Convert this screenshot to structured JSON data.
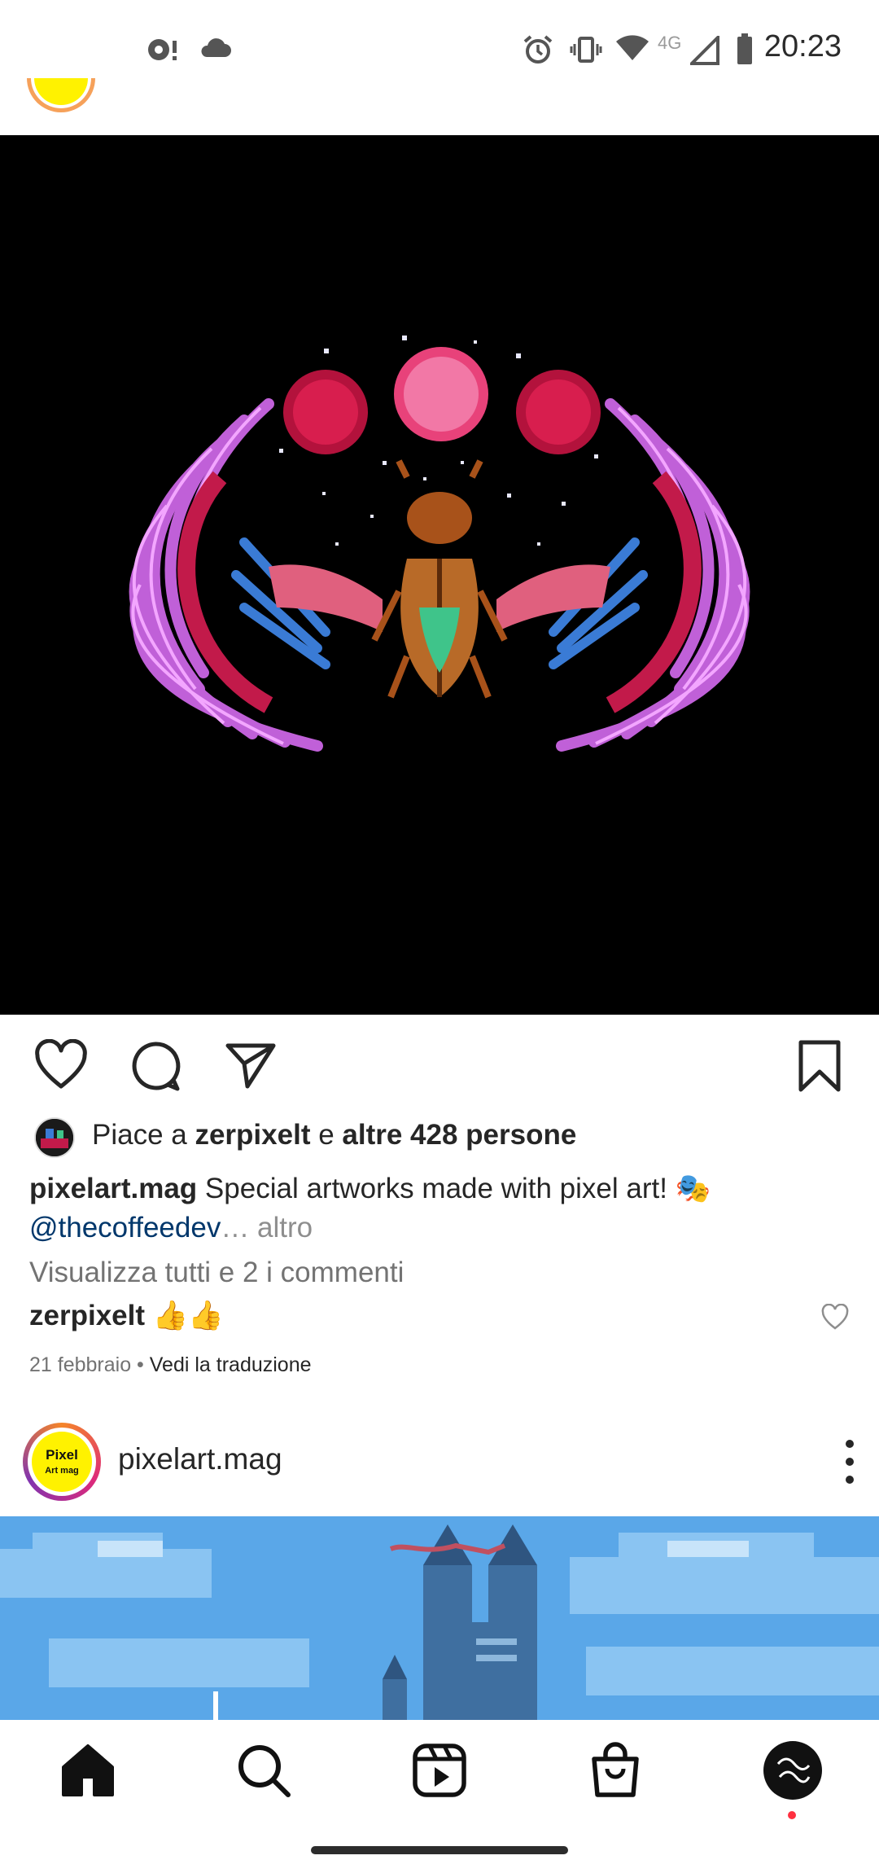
{
  "status_bar": {
    "time": "20:23",
    "network": "4G",
    "icons": [
      "notification-dot-icon",
      "cloud-icon",
      "alarm-icon",
      "vibrate-icon",
      "wifi-icon",
      "cell-signal-icon",
      "battery-icon"
    ]
  },
  "post": {
    "likes": {
      "prefix": "Piace a ",
      "user": "zerpixelt",
      "middle": " e ",
      "others": "altre 428 persone"
    },
    "caption": {
      "username": "pixelart.mag",
      "text": " Special artworks made with pixel art! 🎭",
      "mention": "@thecoffeedev",
      "more": "… altro"
    },
    "view_comments": "Visualizza tutti e 2 i commenti",
    "comment": {
      "username": "zerpixelt",
      "text": " 👍👍"
    },
    "date": "21 febbraio",
    "separator": " • ",
    "translate": "Vedi la traduzione"
  },
  "next_post": {
    "username": "pixelart.mag",
    "avatar_text_line1": "Pixel",
    "avatar_text_line2": "Art mag"
  },
  "colors": {
    "link": "#00376b",
    "muted": "#737373",
    "text": "#262626"
  }
}
